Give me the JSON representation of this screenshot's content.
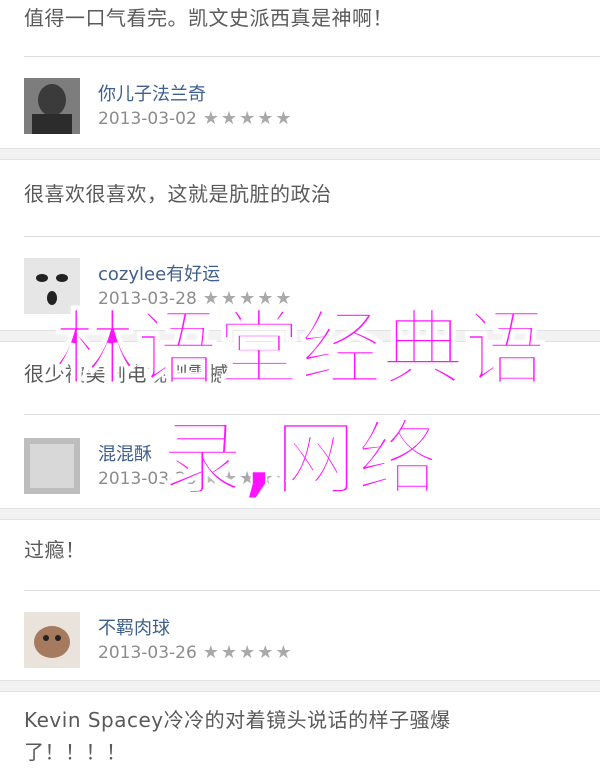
{
  "reviews": [
    {
      "text": "值得一口气看完。凯文史派西真是神啊！",
      "author": "你儿子法兰奇",
      "date": "2013-03-02",
      "stars": "★★★★★"
    },
    {
      "text": "很喜欢很喜欢，这就是肮脏的政治",
      "author": "cozylee有好运",
      "date": "2013-03-28",
      "stars": "★★★★★"
    },
    {
      "text": "很少被美剧电视剧震撼",
      "author": "混混酥",
      "date": "2013-03-25",
      "stars": "★★★★★"
    },
    {
      "text": "过瘾！",
      "author": "不羁肉球",
      "date": "2013-03-26",
      "stars": "★★★★★"
    },
    {
      "text": "Kevin Spacey冷冷的对着镜头说话的样子骚爆了！！！！"
    }
  ],
  "overlay": {
    "line1": "林语堂经典语",
    "line2": "录,网络"
  }
}
